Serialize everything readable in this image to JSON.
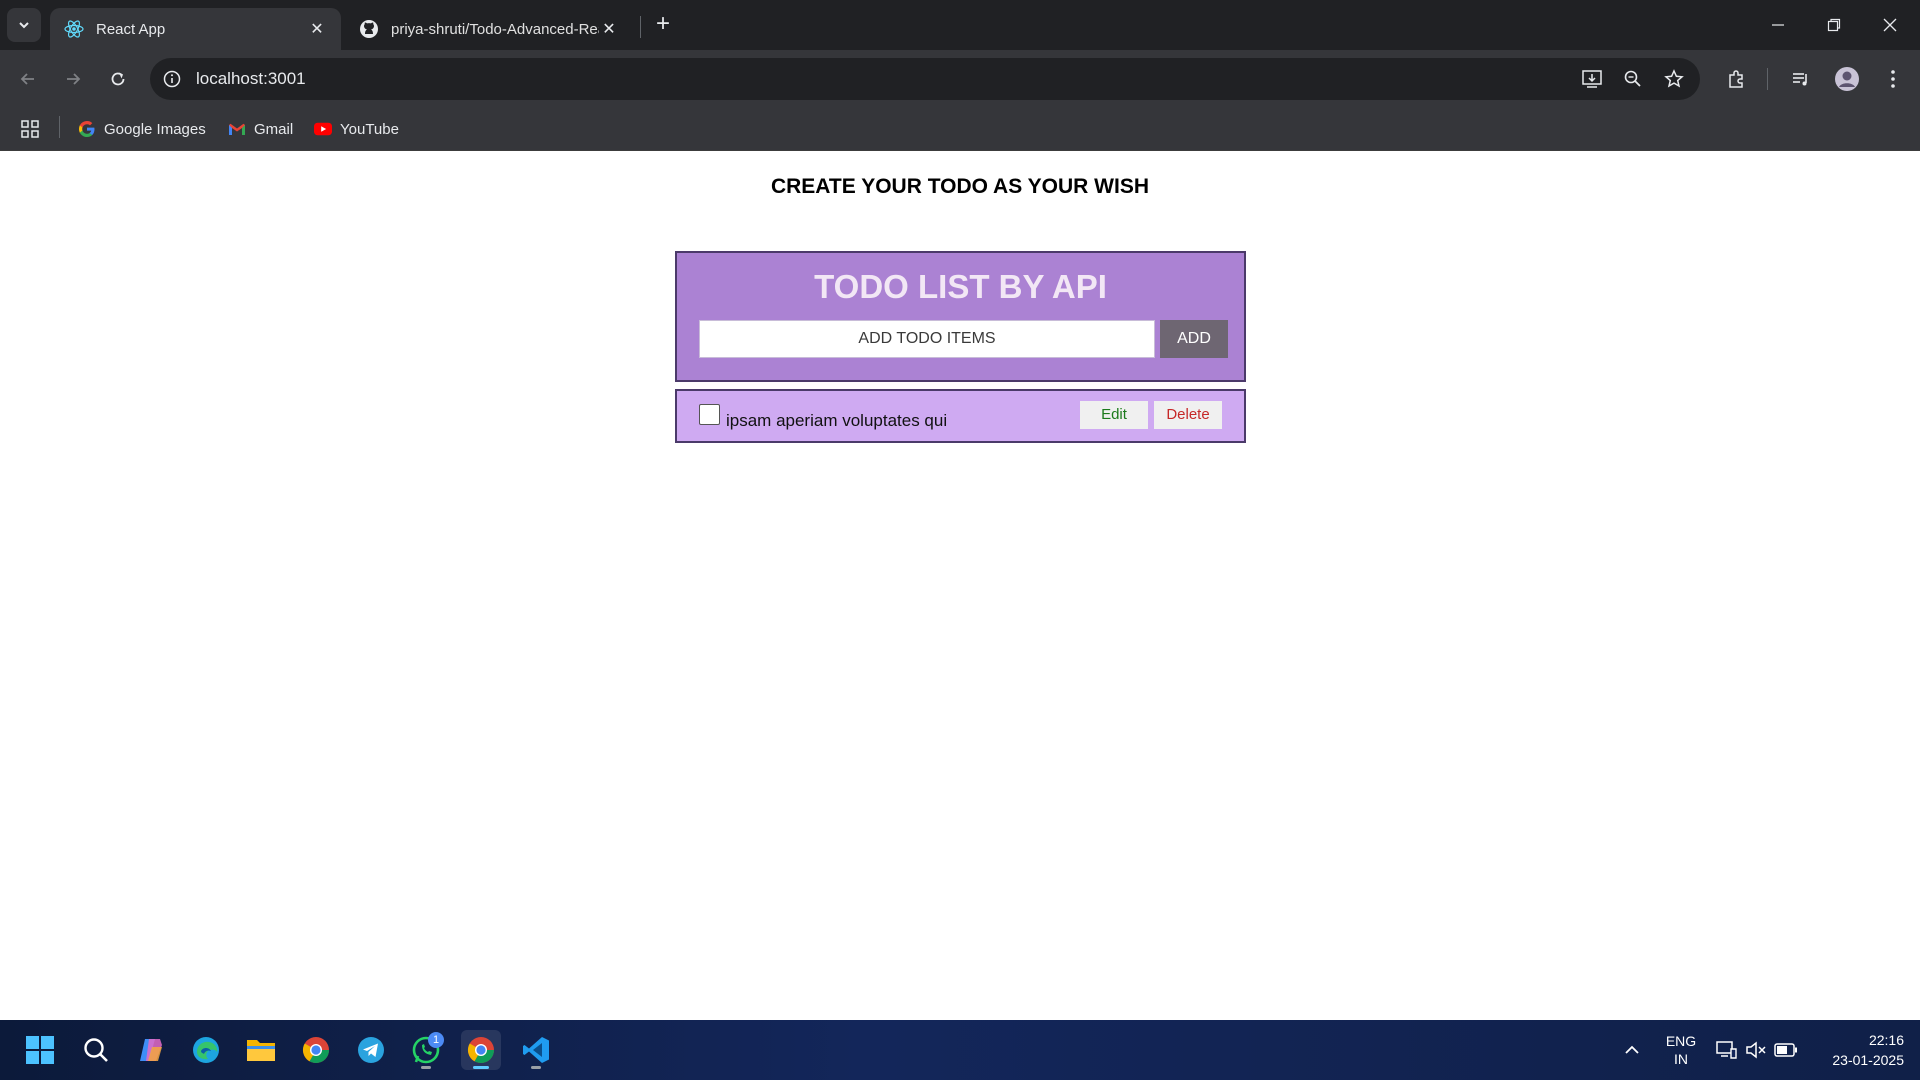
{
  "browser": {
    "tabs": [
      {
        "title": "React App",
        "favicon": "react-icon",
        "active": true
      },
      {
        "title": "priya-shruti/Todo-Advanced-React",
        "favicon": "github-icon",
        "active": false
      }
    ],
    "url": "localhost:3001",
    "bookmarks": [
      {
        "label": "Google Images",
        "icon": "google-icon"
      },
      {
        "label": "Gmail",
        "icon": "gmail-icon"
      },
      {
        "label": "YouTube",
        "icon": "youtube-icon"
      }
    ]
  },
  "page": {
    "heading": "CREATE YOUR TODO AS YOUR WISH",
    "todo": {
      "title": "TODO LIST BY API",
      "input_placeholder": "ADD TODO ITEMS",
      "add_label": "ADD"
    },
    "items": [
      {
        "text": "ipsam aperiam voluptates qui",
        "checked": false,
        "edit_label": "Edit",
        "delete_label": "Delete"
      }
    ]
  },
  "taskbar": {
    "whatsapp_badge": "1",
    "lang_line1": "ENG",
    "lang_line2": "IN",
    "time": "22:16",
    "date": "23-01-2025"
  },
  "colors": {
    "todo_box": "#ab82d3",
    "item_box": "#cfaaf2",
    "add_button": "#6e6672",
    "edit_text": "#1c7a1c",
    "delete_text": "#c62828"
  }
}
